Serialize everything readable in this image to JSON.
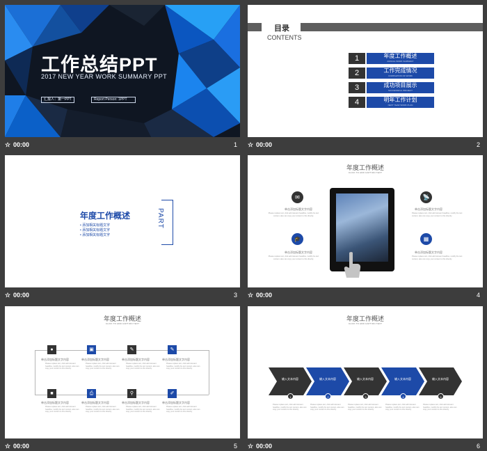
{
  "caption_time": "00:00",
  "slides": [
    {
      "number": "1"
    },
    {
      "number": "2"
    },
    {
      "number": "3"
    },
    {
      "number": "4"
    },
    {
      "number": "5"
    },
    {
      "number": "6"
    }
  ],
  "slide1": {
    "title": "工作总结PPT",
    "subtitle": "2017 NEW YEAR WORK SUMMARY PPT",
    "reporter": "汇报人：第一PPT",
    "reporter_en": "Report Person: 1PPT"
  },
  "slide2": {
    "title": "目录",
    "subtitle": "CONTENTS",
    "items": [
      {
        "num": "1",
        "label": "年度工作概述",
        "sub": "ANNUAL WORK SUMMARY"
      },
      {
        "num": "2",
        "label": "工作完成情况",
        "sub": "COMPLETION OF WORK"
      },
      {
        "num": "3",
        "label": "成功项目展示",
        "sub": "SUCCESSFUL PROJECT"
      },
      {
        "num": "4",
        "label": "明年工作计划",
        "sub": "NEXT YEAR WORK PLAN"
      }
    ]
  },
  "slide3": {
    "title": "年度工作概述",
    "bullets": [
      "添加相关标题文字",
      "添加相关标题文字",
      "添加相关标题文字"
    ],
    "part": "PART"
  },
  "slide4": {
    "title": "年度工作概述",
    "subtitle": "CLICK TO ADD CAPTION TEXT",
    "label": "单击添加标题文字内容",
    "lorem": "Please replace text, click add relevant headline, modify the text content, also can copy your content to this directly."
  },
  "slide5": {
    "title": "年度工作概述",
    "subtitle": "CLICK TO ADD CAPTION TEXT",
    "label": "单击添加标题文字内容",
    "lorem": "Please replace text, click add relevant headline, modify the text content, also can copy your content to this directly."
  },
  "slide6": {
    "title": "年度工作概述",
    "subtitle": "CLICK TO ADD CAPTION TEXT",
    "step_label": "输入文本内容",
    "lorem": "Please replace text, click add relevant headline, modify the text content, also can copy your content to this directly.",
    "steps": [
      "1",
      "2",
      "3",
      "4",
      "5"
    ]
  },
  "colors": {
    "blue": "#1d4aa8",
    "dark": "#333333",
    "bg": "#3d3d3d"
  },
  "icons": [
    "star-icon",
    "mail-icon",
    "graduation-cap-icon",
    "satellite-dish-icon",
    "calculator-icon",
    "user-icon",
    "lock-icon",
    "pen-icon",
    "briefcase-icon",
    "printer-icon",
    "search-icon",
    "brush-icon"
  ]
}
